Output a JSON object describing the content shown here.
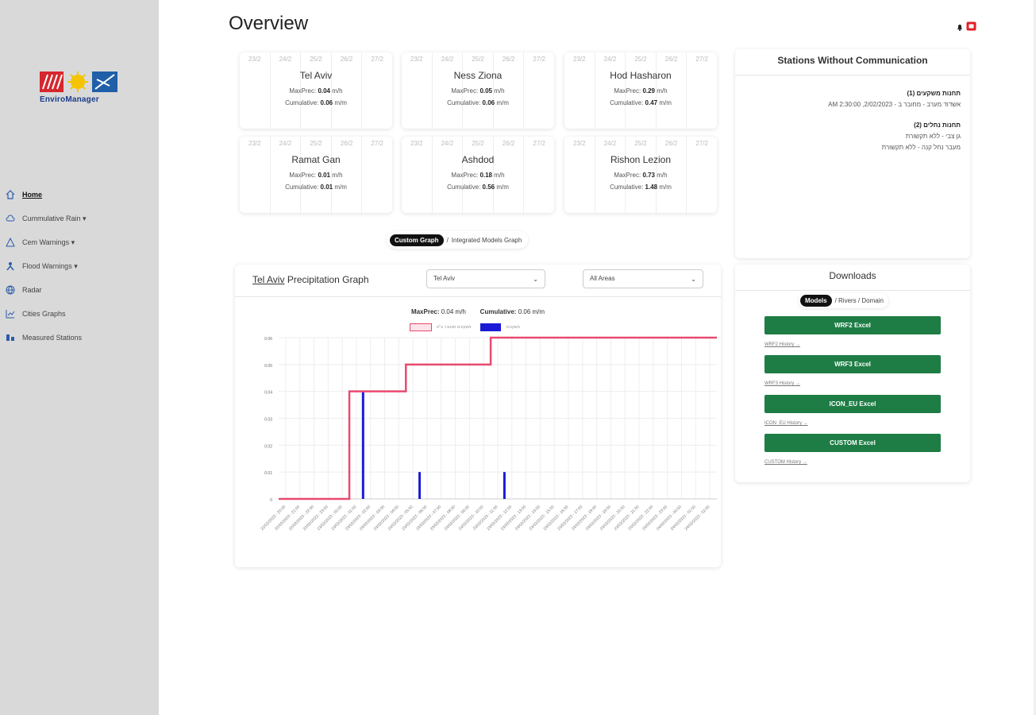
{
  "page": {
    "title": "Overview"
  },
  "brand": {
    "name": "EnviroManager",
    "colors": {
      "red": "#d6262e",
      "yellow": "#f5c400",
      "blue": "#1f5fa8"
    }
  },
  "sidebar": {
    "items": [
      {
        "label": "Home",
        "icon": "home-icon",
        "active": true
      },
      {
        "label": "Cummulative Rain ▾",
        "icon": "cloud-icon",
        "active": false
      },
      {
        "label": "Cem Warnings ▾",
        "icon": "warning-icon",
        "active": false
      },
      {
        "label": "Flood Warnings ▾",
        "icon": "person-icon",
        "active": false
      },
      {
        "label": "Radar",
        "icon": "globe-icon",
        "active": false
      },
      {
        "label": "Cities Graphs",
        "icon": "line-chart-icon",
        "active": false
      },
      {
        "label": "Measured Stations",
        "icon": "stations-icon",
        "active": false
      }
    ]
  },
  "dates": [
    "23/2",
    "24/2",
    "25/2",
    "26/2",
    "27/2"
  ],
  "cities": [
    {
      "name": "Tel Aviv",
      "maxprec": "0.04",
      "cumulative": "0.06"
    },
    {
      "name": "Ness Ziona",
      "maxprec": "0.05",
      "cumulative": "0.06"
    },
    {
      "name": "Hod Hasharon",
      "maxprec": "0.29",
      "cumulative": "0.47"
    },
    {
      "name": "Ramat Gan",
      "maxprec": "0.01",
      "cumulative": "0.01"
    },
    {
      "name": "Ashdod",
      "maxprec": "0.18",
      "cumulative": "0.56"
    },
    {
      "name": "Rishon Lezion",
      "maxprec": "0.73",
      "cumulative": "1.48"
    }
  ],
  "labels": {
    "maxprec": "MaxPrec:",
    "cumulative": "Cumulative:",
    "unit_h": "m/h",
    "unit_m": "m/m"
  },
  "graph_toggle": {
    "active": "Custom Graph",
    "sep": "/",
    "other": "Integrated Models Graph"
  },
  "graph": {
    "title_city": "Tel Aviv",
    "title_rest": "Precipitation Graph",
    "select_city": "Tel Aviv",
    "select_area": "All Areas",
    "stats_maxprec": "0.04 m/h",
    "stats_cumulative": "0.06 m/m",
    "legend_line": "משקעים מצטבר ע\"מ",
    "legend_bar": "משקעים"
  },
  "chart_data": {
    "type": "bar",
    "title": "",
    "x": [
      "22/02/2023 - 20:00",
      "22/02/2023 - 21:00",
      "22/02/2023 - 22:00",
      "22/02/2023 - 23:00",
      "23/02/2023 - 00:00",
      "23/02/2023 - 01:00",
      "23/02/2023 - 02:00",
      "23/02/2023 - 03:00",
      "23/02/2023 - 04:00",
      "23/02/2023 - 05:00",
      "23/02/2023 - 06:00",
      "23/02/2023 - 07:00",
      "23/02/2023 - 08:00",
      "23/02/2023 - 09:00",
      "23/02/2023 - 10:00",
      "23/02/2023 - 11:00",
      "23/02/2023 - 12:00",
      "23/02/2023 - 13:00",
      "23/02/2023 - 14:00",
      "23/02/2023 - 15:00",
      "23/02/2023 - 16:00",
      "23/02/2023 - 17:00",
      "23/02/2023 - 18:00",
      "23/02/2023 - 19:00",
      "23/02/2023 - 20:00",
      "23/02/2023 - 21:00",
      "23/02/2023 - 22:00",
      "23/02/2023 - 23:00",
      "24/02/2023 - 00:00",
      "24/02/2023 - 01:00",
      "24/02/2023 - 02:00"
    ],
    "series": [
      {
        "type": "bar",
        "values": [
          0,
          0,
          0,
          0,
          0,
          0.04,
          0,
          0,
          0,
          0.01,
          0,
          0,
          0,
          0,
          0,
          0.01,
          0,
          0,
          0,
          0,
          0,
          0,
          0,
          0,
          0,
          0,
          0,
          0,
          0,
          0,
          0
        ]
      },
      {
        "type": "line",
        "values": [
          0,
          0,
          0,
          0,
          0,
          0.04,
          0.04,
          0.04,
          0.04,
          0.05,
          0.05,
          0.05,
          0.05,
          0.05,
          0.05,
          0.06,
          0.06,
          0.06,
          0.06,
          0.06,
          0.06,
          0.06,
          0.06,
          0.06,
          0.06,
          0.06,
          0.06,
          0.06,
          0.06,
          0.06,
          0.06
        ]
      }
    ],
    "yticks": [
      "0",
      "0.01",
      "0.02",
      "0.03",
      "0.04",
      "0.05",
      "0.06"
    ],
    "ylim": [
      0,
      0.06
    ],
    "grid": true,
    "colors": {
      "line": "#e84a6f",
      "bar": "#1b1bd6"
    }
  },
  "no_comm": {
    "title": "Stations Without Communication",
    "groups": [
      {
        "heading": "תחנות משקעים (1)",
        "lines": [
          "אשדוד מערב - מחובר ב - 2/02/2023, 2:30:00 AM"
        ]
      },
      {
        "heading": "תחנות נחלים (2)",
        "lines": [
          "גן צבי - ללא תקשורת",
          "מעבר נחל קנה - ללא תקשורת"
        ]
      }
    ]
  },
  "downloads": {
    "title": "Downloads",
    "toggle_active": "Models",
    "toggle_rest": "/ Rivers / Domain",
    "buttons": [
      {
        "label": "WRF2 Excel",
        "link": "WRF2 History →"
      },
      {
        "label": "WRF3 Excel",
        "link": "WRF3 History →"
      },
      {
        "label": "ICON_EU Excel",
        "link": "ICON_EU History →"
      },
      {
        "label": "CUSTOM Excel",
        "link": "CUSTOM History →"
      }
    ]
  }
}
